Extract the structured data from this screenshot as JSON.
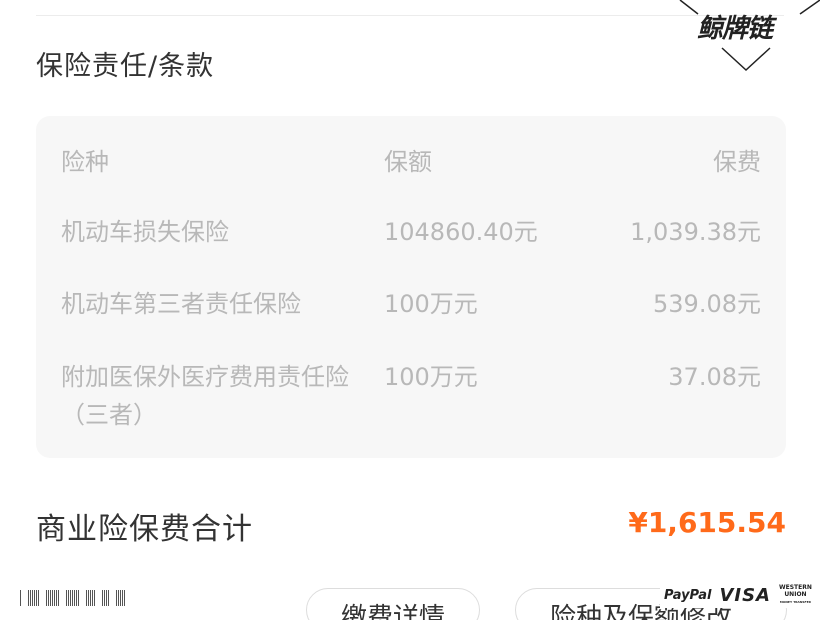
{
  "section": {
    "title": "保险责任/条款"
  },
  "watermark": {
    "text": "鲸牌链"
  },
  "coverage_table": {
    "headers": [
      "险种",
      "保额",
      "保费"
    ],
    "rows": [
      [
        "机动车损失保险",
        "104860.40元",
        "1,039.38元"
      ],
      [
        "机动车第三者责任保险",
        "100万元",
        "539.08元"
      ],
      [
        "附加医保外医疗费用责任险（三者）",
        "100万元",
        "37.08元"
      ]
    ]
  },
  "total": {
    "label": "商业险保费合计",
    "amount": "¥1,615.54",
    "color": "#ff6a1a"
  },
  "bottom": {
    "button_1": "缴费详情",
    "button_2": "险种及保额修改",
    "pay_paypal": "PayPal",
    "pay_visa": "VISA",
    "pay_wu_1": "WESTERN",
    "pay_wu_2": "UNION",
    "pay_wu_3": "MONEY TRANSFER"
  }
}
